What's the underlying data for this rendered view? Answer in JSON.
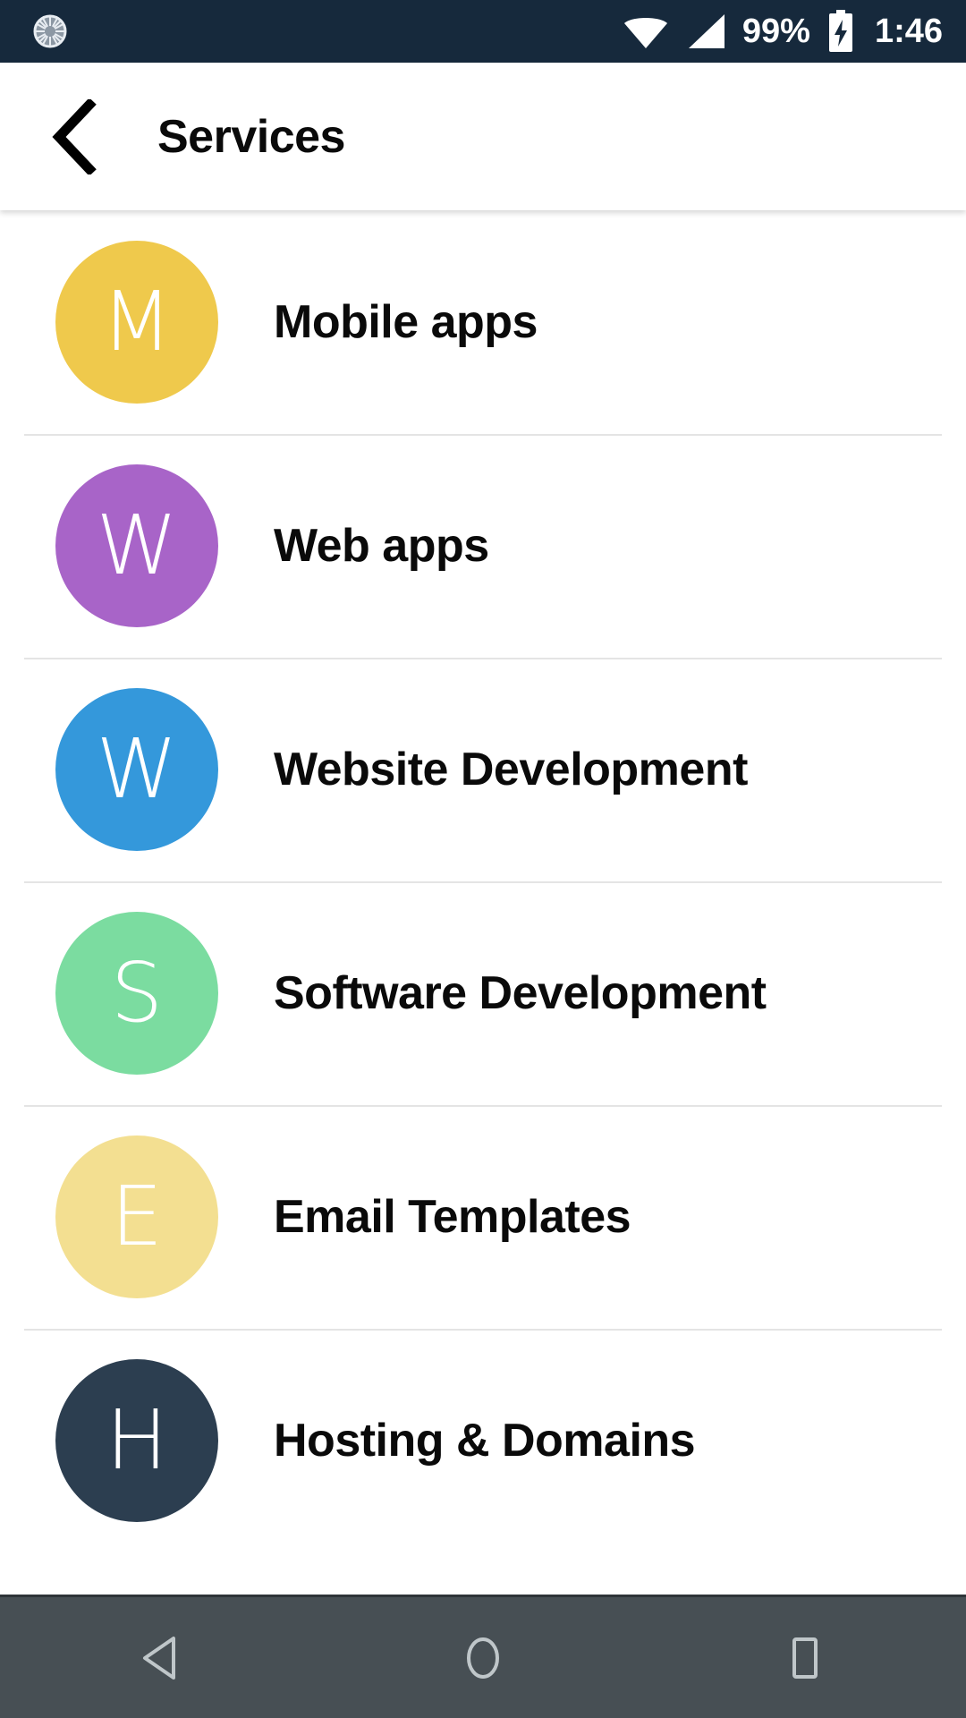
{
  "status_bar": {
    "background_color": "#16293C",
    "loader_icon": "spinner-icon",
    "wifi_icon": "wifi-icon",
    "signal_icon": "cellular-signal-icon",
    "battery_percent": "99%",
    "battery_icon": "battery-charging-icon",
    "clock": "1:46"
  },
  "app_bar": {
    "back_icon": "back-chevron-icon",
    "title": "Services"
  },
  "list": {
    "items": [
      {
        "initial": "M",
        "label": "Mobile apps",
        "color": "#EFC94C"
      },
      {
        "initial": "W",
        "label": "Web apps",
        "color": "#A864C8"
      },
      {
        "initial": "W",
        "label": "Website Development",
        "color": "#3498DB"
      },
      {
        "initial": "S",
        "label": "Software Development",
        "color": "#7BDCA0"
      },
      {
        "initial": "E",
        "label": "Email Templates",
        "color": "#F3DF91"
      },
      {
        "initial": "H",
        "label": "Hosting & Domains",
        "color": "#2C3E50"
      }
    ]
  },
  "nav_bar": {
    "background_color": "#474F54",
    "icon_color": "#BFC6C9",
    "back_icon": "nav-back-triangle-icon",
    "home_icon": "nav-home-circle-icon",
    "recents_icon": "nav-recents-square-icon"
  }
}
